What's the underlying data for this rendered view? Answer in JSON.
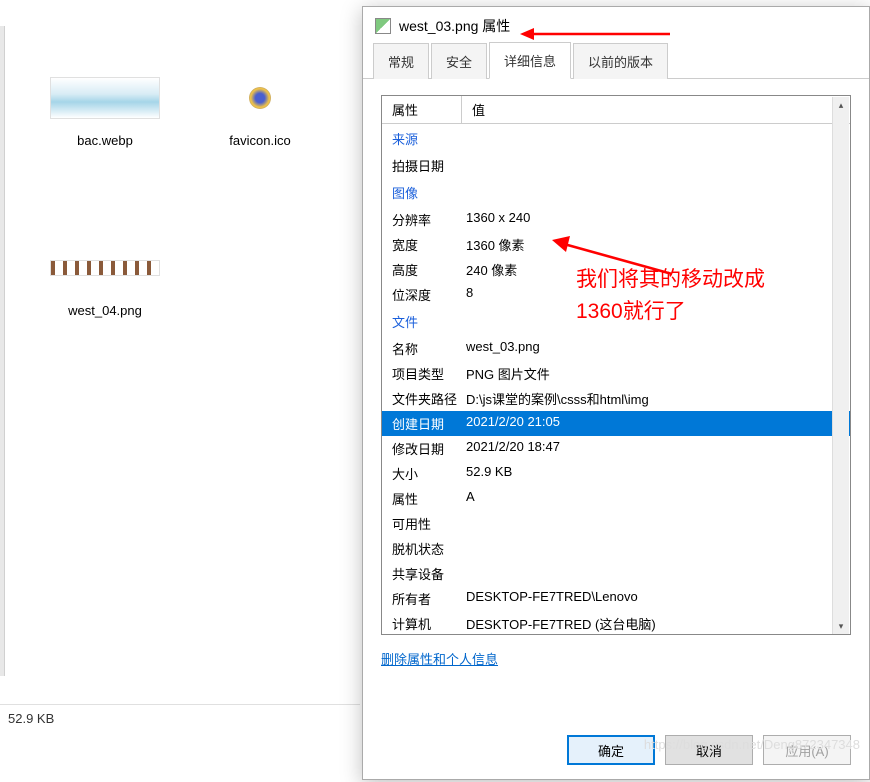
{
  "explorer": {
    "files": [
      {
        "label": "bac.webp"
      },
      {
        "label": "favicon.ico"
      },
      {
        "label": "west_04.png"
      }
    ],
    "status": "52.9 KB"
  },
  "dialog": {
    "title": "west_03.png 属性",
    "tabs": [
      "常规",
      "安全",
      "详细信息",
      "以前的版本"
    ],
    "header": {
      "prop": "属性",
      "val": "值"
    },
    "sections": {
      "origin": "来源",
      "image": "图像",
      "file": "文件"
    },
    "rows": {
      "shot_date": {
        "k": "拍摄日期",
        "v": ""
      },
      "resolution": {
        "k": "分辨率",
        "v": "1360 x 240"
      },
      "width": {
        "k": "宽度",
        "v": "1360 像素"
      },
      "height": {
        "k": "高度",
        "v": "240 像素"
      },
      "bitdepth": {
        "k": "位深度",
        "v": "8"
      },
      "name": {
        "k": "名称",
        "v": "west_03.png"
      },
      "type": {
        "k": "项目类型",
        "v": "PNG 图片文件"
      },
      "path": {
        "k": "文件夹路径",
        "v": "D:\\js课堂的案例\\csss和html\\img"
      },
      "created": {
        "k": "创建日期",
        "v": "2021/2/20 21:05"
      },
      "modified": {
        "k": "修改日期",
        "v": "2021/2/20 18:47"
      },
      "size": {
        "k": "大小",
        "v": "52.9 KB"
      },
      "attr": {
        "k": "属性",
        "v": "A"
      },
      "avail": {
        "k": "可用性",
        "v": ""
      },
      "offline": {
        "k": "脱机状态",
        "v": ""
      },
      "share": {
        "k": "共享设备",
        "v": ""
      },
      "owner": {
        "k": "所有者",
        "v": "DESKTOP-FE7TRED\\Lenovo"
      },
      "computer": {
        "k": "计算机",
        "v": "DESKTOP-FE7TRED (这台电脑)"
      }
    },
    "remove_link": "删除属性和个人信息",
    "buttons": {
      "ok": "确定",
      "cancel": "取消",
      "apply": "应用(A)"
    }
  },
  "annotation": {
    "line1": "我们将其的移动改成",
    "line2": "1360就行了"
  },
  "watermark": "https://blog.csdn.net/Deng872347348"
}
